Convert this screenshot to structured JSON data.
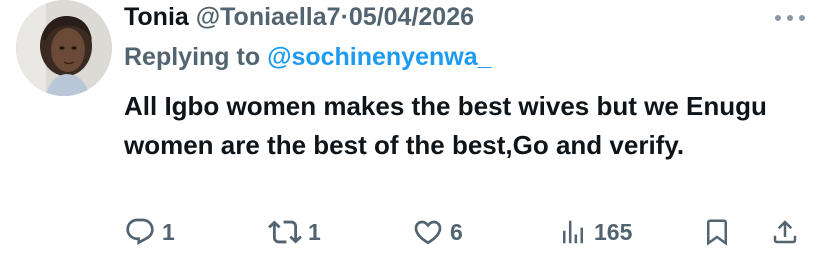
{
  "tweet": {
    "author_name": "Tonia",
    "author_handle": "@Toniaella7",
    "separator": "·",
    "date": "05/04/2026",
    "replying_label": "Replying to",
    "replying_to": "@sochinenyenwa_",
    "text": "All Igbo women makes the best wives but we Enugu women are the best of the best,Go and verify."
  },
  "actions": {
    "replies": "1",
    "reposts": "1",
    "likes": "6",
    "views": "165"
  },
  "icons": {
    "reply": "reply-icon",
    "repost": "repost-icon",
    "like": "heart-icon",
    "views": "views-icon",
    "bookmark": "bookmark-icon",
    "share": "share-icon",
    "more": "more-icon"
  },
  "colors": {
    "text": "#0f1419",
    "secondary": "#536471",
    "accent": "#1d9bf0"
  }
}
